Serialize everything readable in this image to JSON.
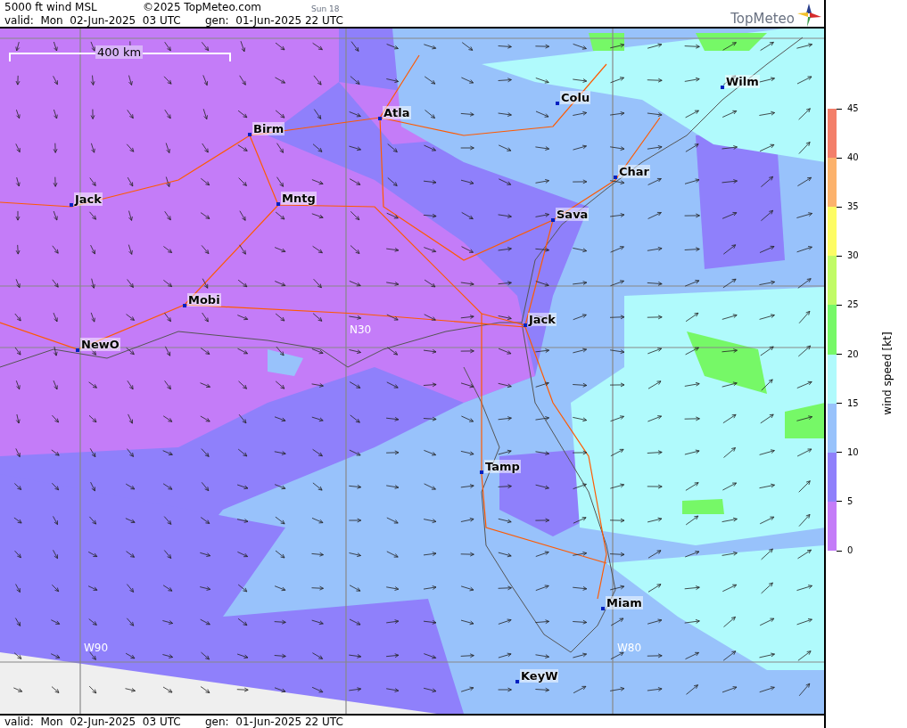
{
  "header": {
    "title": "5000 ft wind MSL",
    "copyright": "©2025 TopMeteo.com",
    "run_label": "Sun 18",
    "valid": "valid:  Mon  02-Jun-2025  03 UTC",
    "generated": "gen:  01-Jun-2025 22 UTC",
    "logo": "TopMeteo"
  },
  "map": {
    "scale_bar": "400 km",
    "cities": [
      {
        "name": "Jack"
      },
      {
        "name": "Birm"
      },
      {
        "name": "Mntg"
      },
      {
        "name": "Atla"
      },
      {
        "name": "Colu"
      },
      {
        "name": "Wilm"
      },
      {
        "name": "Char"
      },
      {
        "name": "Sava"
      },
      {
        "name": "Mobi"
      },
      {
        "name": "NewO"
      },
      {
        "name": "Jack"
      },
      {
        "name": "Tamp"
      },
      {
        "name": "Miam"
      },
      {
        "name": "KeyW"
      }
    ],
    "grid_labels": [
      "N30",
      "W90",
      "W80"
    ]
  },
  "legend": {
    "title": "wind speed [kt]",
    "bands": [
      {
        "color": "#f37f6a"
      },
      {
        "color": "#fcb26c"
      },
      {
        "color": "#fdfc64"
      },
      {
        "color": "#c1fb66"
      },
      {
        "color": "#76f867"
      },
      {
        "color": "#b0fafc"
      },
      {
        "color": "#98c2fb"
      },
      {
        "color": "#8f80fb"
      },
      {
        "color": "#c47cf8"
      }
    ],
    "ticks": [
      "45",
      "40",
      "35",
      "30",
      "25",
      "20",
      "15",
      "10",
      "5",
      "0"
    ]
  },
  "footer": {
    "valid": "valid:  Mon  02-Jun-2025  03 UTC",
    "generated": "gen:  01-Jun-2025 22 UTC"
  }
}
